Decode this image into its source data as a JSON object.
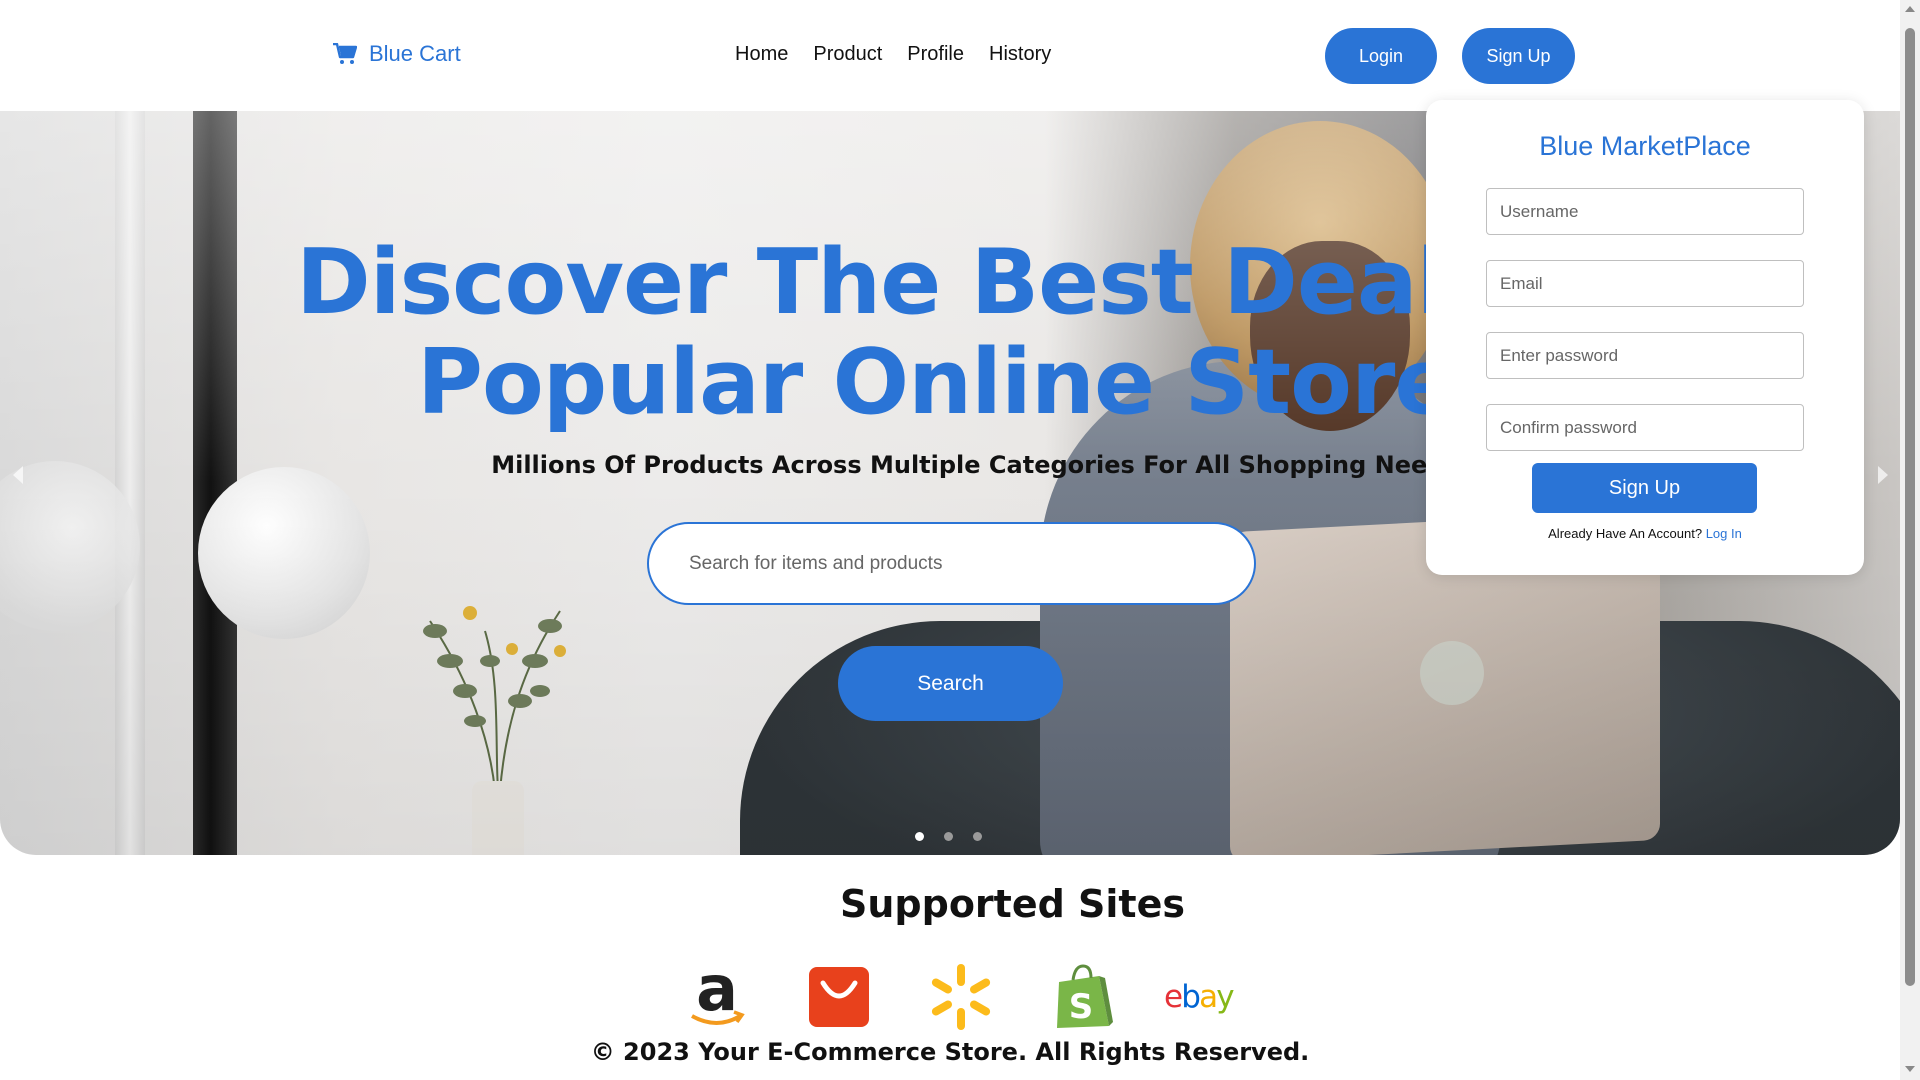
{
  "header": {
    "brand_name": "Blue Cart",
    "brand_icon": "shopping-cart-icon",
    "nav": [
      "Home",
      "Product",
      "Profile",
      "History"
    ],
    "login_label": "Login",
    "signup_label": "Sign Up"
  },
  "hero": {
    "headline_line1": "Discover The Best Deals On",
    "headline_line2": "Popular Online Stores",
    "subheadline": "Millions Of Products Across Multiple Categories For All Shopping Needs",
    "search_placeholder": "Search for items and products",
    "search_value": "",
    "search_button": "Search",
    "slides_total": 3,
    "active_slide": 1
  },
  "signup_card": {
    "title": "Blue MarketPlace",
    "username_placeholder": "Username",
    "email_placeholder": "Email",
    "password_placeholder": "Enter password",
    "confirm_placeholder": "Confirm password",
    "submit_label": "Sign Up",
    "footer_text": "Already Have An Account?",
    "footer_link": "Log In"
  },
  "supported": {
    "title": "Supported Sites",
    "sites": [
      "amazon-icon",
      "aliexpress-icon",
      "walmart-icon",
      "shopify-icon",
      "ebay-icon"
    ]
  },
  "footer": {
    "copyright": "© 2023 Your E-Commerce Store. All Rights Reserved."
  },
  "colors": {
    "accent": "#2a74d6"
  }
}
